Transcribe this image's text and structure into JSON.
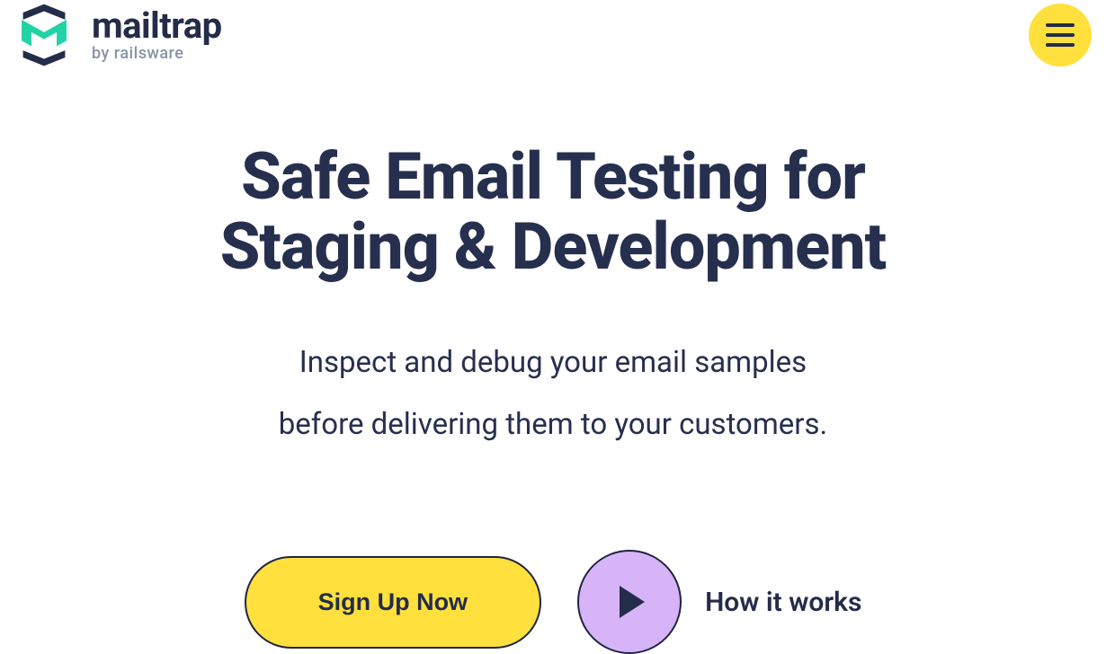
{
  "brand": {
    "name": "mailtrap",
    "byline": "by railsware"
  },
  "hero": {
    "title_line1": "Safe Email Testing for",
    "title_line2": "Staging & Development",
    "subtitle_line1": "Inspect and debug your email samples",
    "subtitle_line2": "before delivering them to your customers."
  },
  "cta": {
    "signup": "Sign Up Now",
    "howitworks": "How it works"
  },
  "colors": {
    "navy": "#242c4a",
    "yellow": "#ffe03d",
    "teal": "#22d3a5",
    "lavender": "#d6b4f7"
  }
}
